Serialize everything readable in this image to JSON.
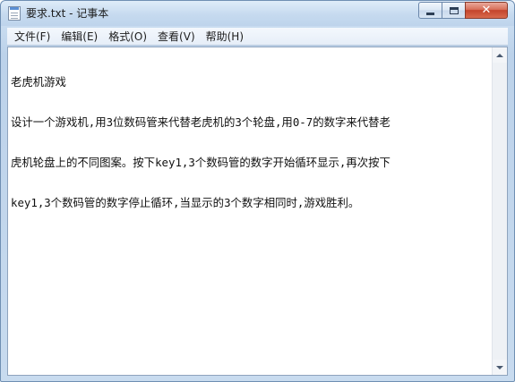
{
  "window": {
    "title": "要求.txt - 记事本",
    "controls": {
      "minimize_icon": "minimize-icon",
      "maximize_icon": "maximize-icon",
      "close_icon": "close-icon",
      "close_glyph": "✕"
    }
  },
  "menu": {
    "items": [
      {
        "label": "文件(F)"
      },
      {
        "label": "编辑(E)"
      },
      {
        "label": "格式(O)"
      },
      {
        "label": "查看(V)"
      },
      {
        "label": "帮助(H)"
      }
    ]
  },
  "document": {
    "lines": [
      "老虎机游戏",
      "设计一个游戏机,用3位数码管来代替老虎机的3个轮盘,用0-7的数字来代替老",
      "虎机轮盘上的不同图案。按下key1,3个数码管的数字开始循环显示,再次按下",
      "key1,3个数码管的数字停止循环,当显示的3个数字相同时,游戏胜利。"
    ]
  },
  "colors": {
    "title_bar": "#c6daef",
    "close_button": "#c4442b",
    "editor_background": "#ffffff"
  }
}
